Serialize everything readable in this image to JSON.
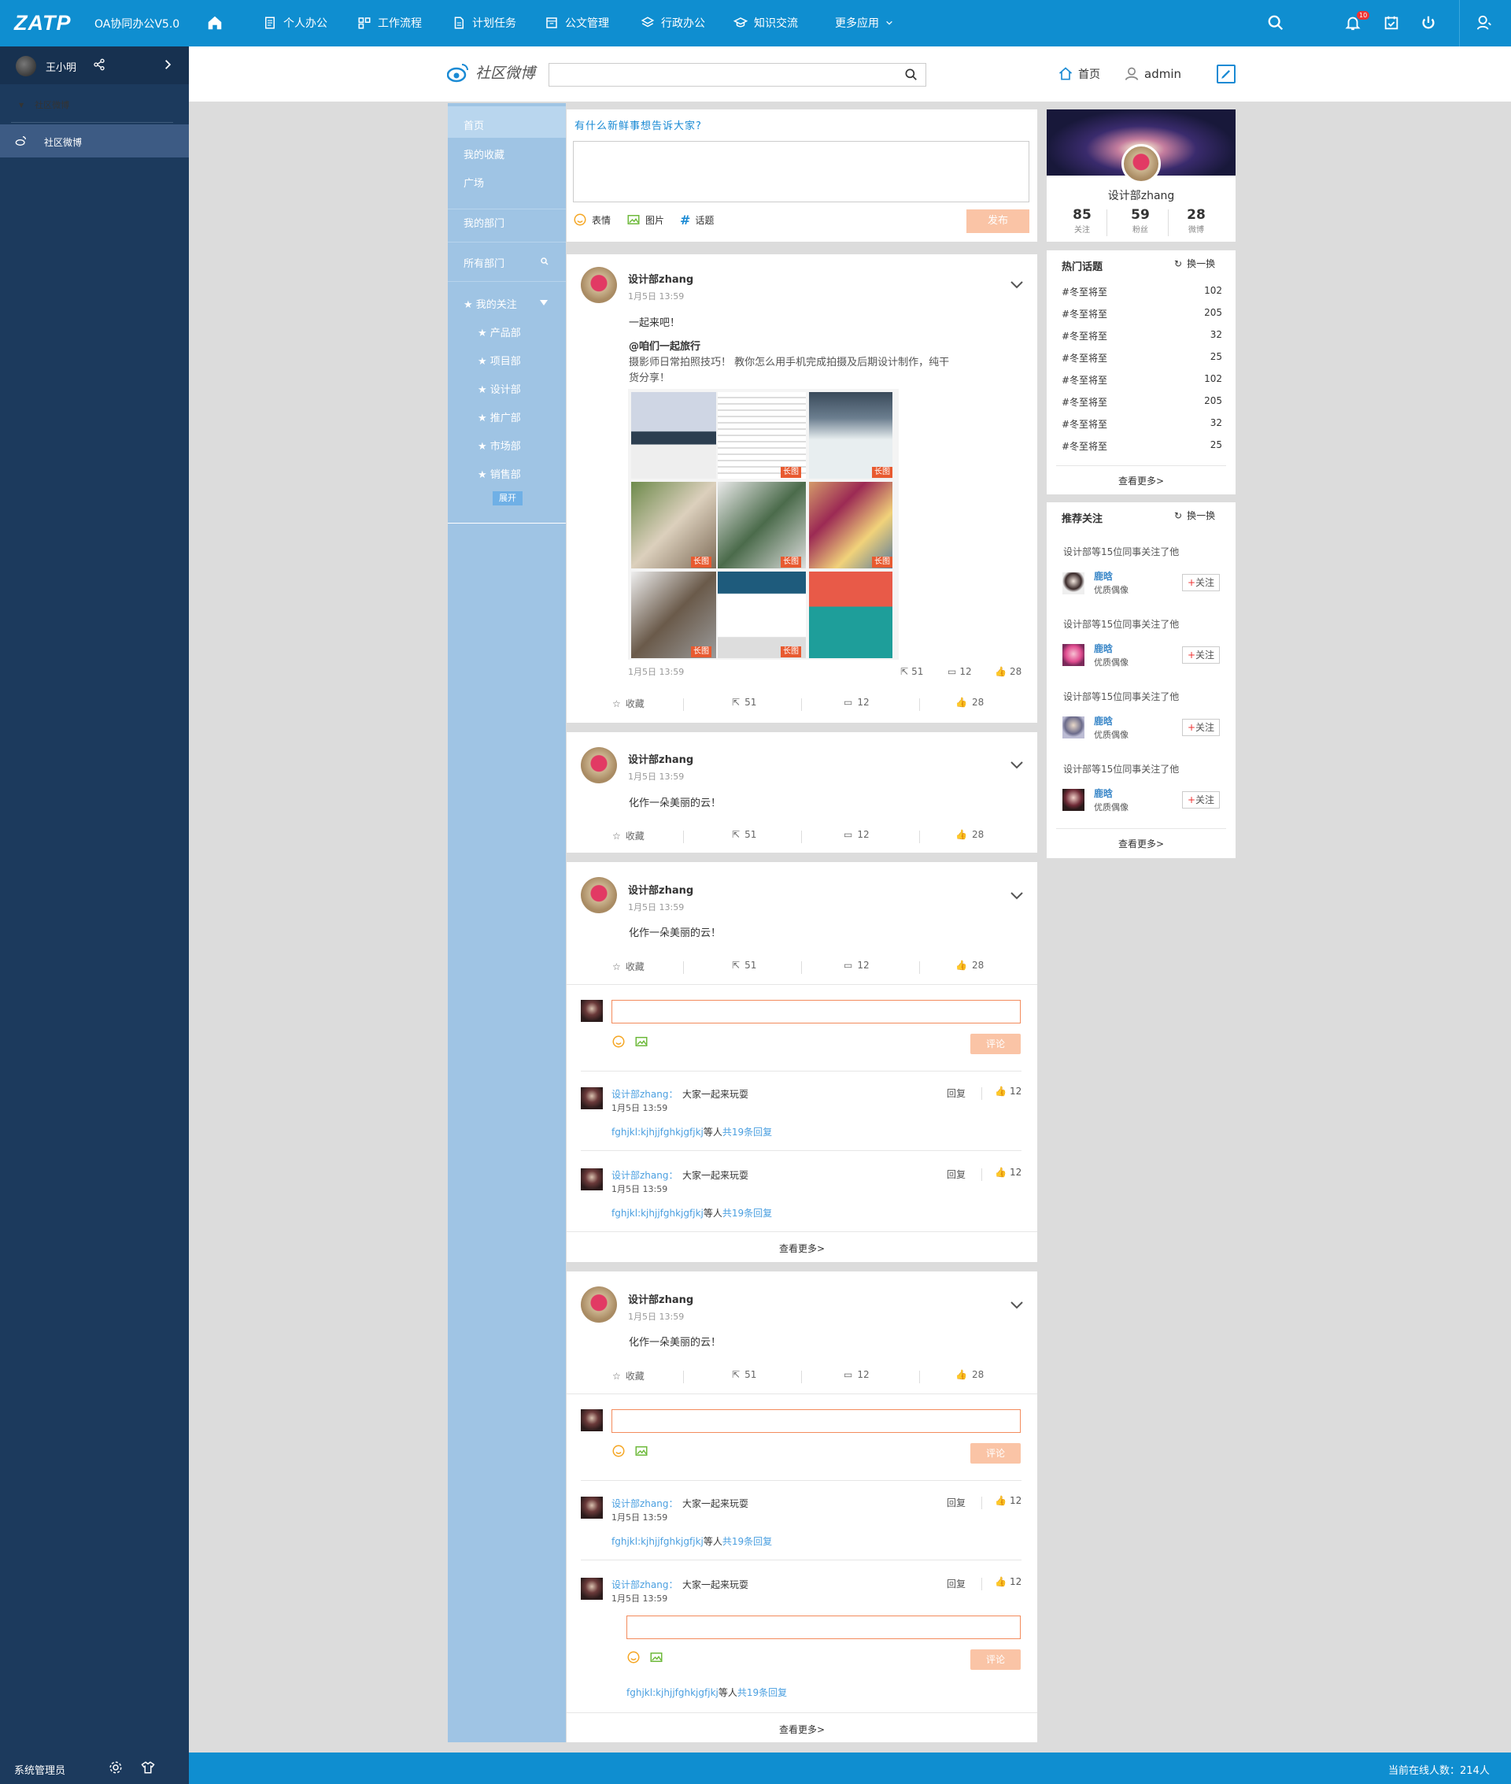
{
  "topbar": {
    "logo": "ZATP",
    "app_title": "OA协同办公V5.0",
    "nav": [
      "个人办公",
      "工作流程",
      "计划任务",
      "公文管理",
      "行政办公",
      "知识交流",
      "更多应用"
    ],
    "notification_count": "10"
  },
  "sidebar": {
    "user_name": "王小明",
    "tree_parent": "社区微博",
    "tree_child": "社区微博",
    "footer_label": "系统管理员"
  },
  "footer": {
    "online_text": "当前在线人数：214人"
  },
  "subheader": {
    "brand": "社区微博",
    "search_placeholder": "",
    "home_label": "首页",
    "user_label": "admin"
  },
  "leftnav": {
    "items": [
      "首页",
      "我的收藏",
      "广场",
      "我的部门",
      "所有部门"
    ],
    "follow_header": "我的关注",
    "departments": [
      "产品部",
      "项目部",
      "设计部",
      "推广部",
      "市场部",
      "销售部"
    ],
    "expand": "展开"
  },
  "composer": {
    "prompt": "有什么新鲜事想告诉大家?",
    "emoji": "表情",
    "image": "图片",
    "topic": "话题",
    "publish": "发布"
  },
  "posts": [
    {
      "author": "设计部zhang",
      "time": "1月5日  13:59",
      "text": "一起来吧！",
      "share_title": "@咱们一起旅行",
      "share_text_1": "摄影师日常拍照技巧！ 教你怎么用手机完成拍摄及后期设计制作，纯干",
      "share_text_2": "货分享！",
      "inner_time": "1月5日  13:59",
      "inner_stats": [
        "51",
        "12",
        "28"
      ],
      "long_tag": "长图",
      "actions": {
        "fav": "收藏",
        "share": "51",
        "comment": "12",
        "like": "28"
      }
    },
    {
      "author": "设计部zhang",
      "time": "1月5日  13:59",
      "text": "化作一朵美丽的云！",
      "actions": {
        "fav": "收藏",
        "share": "51",
        "comment": "12",
        "like": "28"
      }
    },
    {
      "author": "设计部zhang",
      "time": "1月5日  13:59",
      "text": "化作一朵美丽的云！",
      "actions": {
        "fav": "收藏",
        "share": "51",
        "comment": "12",
        "like": "28"
      },
      "comment_btn": "评论",
      "comments": [
        {
          "name": "设计部zhang：",
          "body": "大家一起来玩耍",
          "time": "1月5日  13:59",
          "reply": "回复",
          "likes": "12",
          "link_name": "fghjkl:kjhjjfghkjgfjkj",
          "link_mid": "等人",
          "link_tail": "共19条回复"
        },
        {
          "name": "设计部zhang：",
          "body": "大家一起来玩耍",
          "time": "1月5日  13:59",
          "reply": "回复",
          "likes": "12",
          "link_name": "fghjkl:kjhjjfghkjgfjkj",
          "link_mid": "等人",
          "link_tail": "共19条回复"
        }
      ],
      "more": "查看更多>"
    },
    {
      "author": "设计部zhang",
      "time": "1月5日  13:59",
      "text": "化作一朵美丽的云！",
      "actions": {
        "fav": "收藏",
        "share": "51",
        "comment": "12",
        "like": "28"
      },
      "comment_btn": "评论",
      "comments": [
        {
          "name": "设计部zhang：",
          "body": "大家一起来玩耍",
          "time": "1月5日  13:59",
          "reply": "回复",
          "likes": "12",
          "link_name": "fghjkl:kjhjjfghkjgfjkj",
          "link_mid": "等人",
          "link_tail": "共19条回复"
        },
        {
          "name": "设计部zhang：",
          "body": "大家一起来玩耍",
          "time": "1月5日  13:59",
          "reply": "回复",
          "likes": "12",
          "link_name": "fghjkl:kjhjjfghkjgfjkj",
          "link_mid": "等人",
          "link_tail": "共19条回复"
        }
      ],
      "more": "查看更多>"
    }
  ],
  "profile": {
    "name": "设计部zhang",
    "stats": [
      {
        "n": "85",
        "l": "关注"
      },
      {
        "n": "59",
        "l": "粉丝"
      },
      {
        "n": "28",
        "l": "微博"
      }
    ]
  },
  "hot": {
    "title": "热门话题",
    "swap": "换一换",
    "topics": [
      {
        "name": "#冬至将至",
        "count": "102"
      },
      {
        "name": "#冬至将至",
        "count": "205"
      },
      {
        "name": "#冬至将至",
        "count": "32"
      },
      {
        "name": "#冬至将至",
        "count": "25"
      },
      {
        "name": "#冬至将至",
        "count": "102"
      },
      {
        "name": "#冬至将至",
        "count": "205"
      },
      {
        "name": "#冬至将至",
        "count": "32"
      },
      {
        "name": "#冬至将至",
        "count": "25"
      }
    ],
    "more": "查看更多>"
  },
  "recommend": {
    "title": "推荐关注",
    "swap": "换一换",
    "items": [
      {
        "note": "设计部等15位同事关注了他",
        "name": "鹿晗",
        "desc": "优质偶像",
        "follow": "关注"
      },
      {
        "note": "设计部等15位同事关注了他",
        "name": "鹿晗",
        "desc": "优质偶像",
        "follow": "关注"
      },
      {
        "note": "设计部等15位同事关注了他",
        "name": "鹿晗",
        "desc": "优质偶像",
        "follow": "关注"
      },
      {
        "note": "设计部等15位同事关注了他",
        "name": "鹿晗",
        "desc": "优质偶像",
        "follow": "关注"
      }
    ],
    "more": "查看更多>"
  },
  "colors": {
    "primary": "#0f8ed0",
    "sidebar": "#1c3a5d",
    "accent": "#f38b5c",
    "leftnav": "#9fc4e4"
  }
}
